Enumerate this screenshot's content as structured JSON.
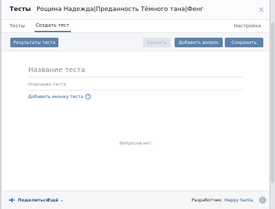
{
  "header": {
    "app_title": "Тесты",
    "title": "Рощина Надежда|Преданность Тёмного тана|Фенг",
    "close_glyph": "×"
  },
  "tabs": {
    "items": [
      {
        "label": "Тесты",
        "active": false
      },
      {
        "label": "Создать тест",
        "active": true
      }
    ],
    "settings_label": "Настройки"
  },
  "toolbar": {
    "results_label": "Результаты теста",
    "delete_label": "Удалить",
    "add_question_label": "Добавить вопрос",
    "save_label": "Сохранить",
    "accent_color": "#5e81a8"
  },
  "form": {
    "name_placeholder": "Название теста",
    "description_placeholder": "Описание теста",
    "add_icon_label": "Добавить иконку теста",
    "help_glyph": "?"
  },
  "content": {
    "empty_text": "Вопросов нет"
  },
  "footer": {
    "share_label": "Поделиться",
    "more_label": "Ещё ⌄",
    "developer_prefix": "Разработчик: ",
    "developer_name": "Happy Santa",
    "info_glyph": "i",
    "icons": [
      "megaphone-icon",
      "info-icon"
    ]
  }
}
